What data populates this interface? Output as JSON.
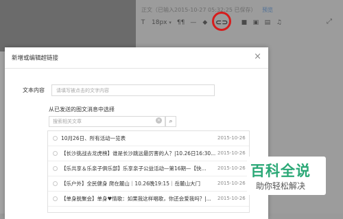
{
  "editor": {
    "status_text": "正文（已输入2015-10-27 05:32:25 已保存）",
    "status_link": "预览",
    "toolbar": [
      "T",
      "18px",
      "¶¶",
      "—",
      "🔗",
      "⊙",
      "▭",
      "▣",
      "♫"
    ],
    "font_size": "18px"
  },
  "modal": {
    "title": "新增或编辑超链接",
    "text_label": "文本内容",
    "text_placeholder": "请填写被点击的文字内容",
    "section_label": "从已发送的图文消息中选择",
    "search_placeholder": "搜索相关文章",
    "articles": [
      {
        "title": "10月26日、所有活动一览表",
        "date": "2015-10-26"
      },
      {
        "title": "【长沙挑战去龙虎榜】谁是长沙跳远最厉害的人？|10.26日16:30...",
        "date": "2015-10-26"
      },
      {
        "title": "【乐共享＆乐亲子俱乐部】乐享亲子公益活动—第16期—【快...",
        "date": "2015-10-26"
      },
      {
        "title": "【乐户外】全民健身 爬在麓山｜10.26晚19:15｜岳麓山大门",
        "date": "2015-10-26"
      },
      {
        "title": "【单身脱聚会】单身♥情歌：如果我这样唱歌，你还会爱我吗？|...",
        "date": "2015-10-26"
      }
    ]
  },
  "watermark": {
    "title": "百科全说",
    "subtitle": "助你轻松解决"
  }
}
